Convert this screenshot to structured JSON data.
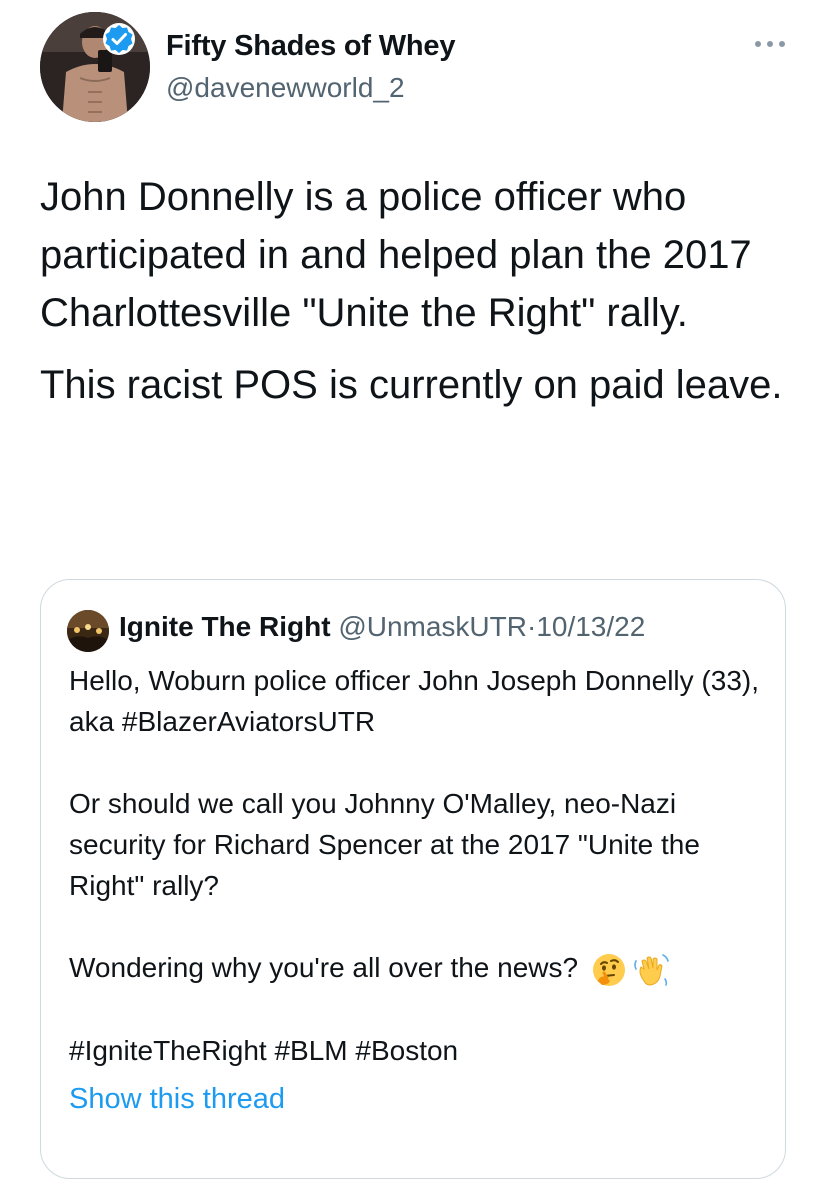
{
  "tweet": {
    "author": {
      "display_name": "Fifty Shades of Whey",
      "handle": "@davenewworld_2",
      "verified": true,
      "avatar_icon": "profile-photo"
    },
    "more_icon": "more-dots-icon",
    "paragraphs": [
      "John Donnelly is a police officer who participated in and helped plan the 2017 Charlottesville \"Unite the Right\" rally.",
      "This racist POS is currently on paid leave."
    ]
  },
  "quoted": {
    "author": {
      "display_name": "Ignite The Right",
      "handle": "@UnmaskUTR",
      "separator": "·",
      "date": "10/13/22"
    },
    "paragraphs": [
      "Hello, Woburn police officer John Joseph Donnelly (33), aka #BlazerAviatorsUTR",
      "Or should we call you Johnny O'Malley, neo-Nazi security for Richard Spencer at the 2017 \"Unite the Right\" rally?",
      "Wondering why you're all over the news?",
      "#IgniteTheRight #BLM #Boston"
    ],
    "emojis": [
      "thinking-face-emoji",
      "waving-hand-emoji"
    ],
    "show_thread": "Show this thread"
  },
  "colors": {
    "text": "#0f1419",
    "secondary": "#536471",
    "link": "#1d9bf0",
    "border": "#cfd9de",
    "verified": "#1d9bf0"
  }
}
